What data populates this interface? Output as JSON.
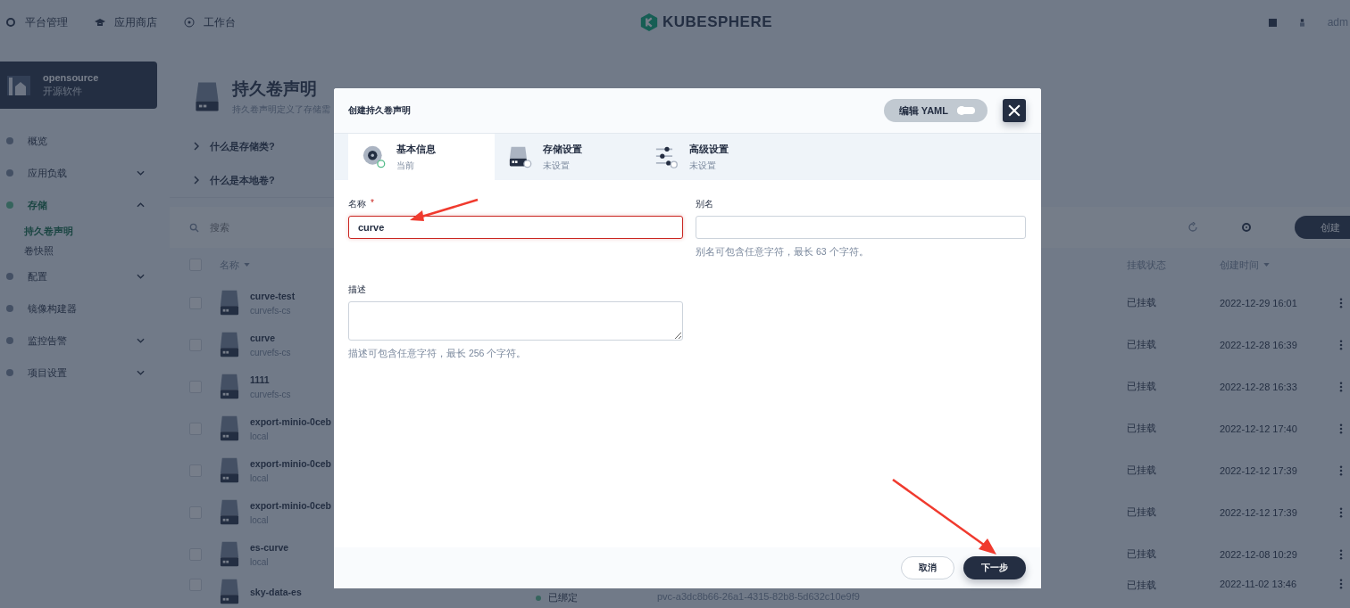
{
  "top_nav": [
    {
      "label": "平台管理",
      "kind": "gear"
    },
    {
      "label": "应用商店",
      "kind": "cap"
    },
    {
      "label": "工作台",
      "kind": "dot"
    }
  ],
  "logo": {
    "text": "KUBESPHERE"
  },
  "user": {
    "name": "adm"
  },
  "workspace": {
    "name": "opensource",
    "description": "开源软件"
  },
  "sidebar": {
    "items": [
      {
        "label": "概览",
        "kind": "link",
        "selected": false
      },
      {
        "label": "应用负载",
        "kind": "group",
        "selected": false,
        "expanded": false
      },
      {
        "label": "存储",
        "kind": "group",
        "selected": true,
        "expanded": true,
        "children": [
          {
            "label": "持久卷声明",
            "selected": true
          },
          {
            "label": "卷快照",
            "selected": false
          }
        ]
      },
      {
        "label": "配置",
        "kind": "group",
        "selected": false,
        "expanded": false
      },
      {
        "label": "镜像构建器",
        "kind": "link",
        "selected": false
      },
      {
        "label": "监控告警",
        "kind": "group",
        "selected": false,
        "expanded": false
      },
      {
        "label": "项目设置",
        "kind": "group",
        "selected": false,
        "expanded": false
      }
    ]
  },
  "page_header": {
    "title": "持久卷声明",
    "description": "持久卷声明定义了存储需"
  },
  "faq": [
    {
      "question": "什么是存储类?",
      "expanded": false
    },
    {
      "question": "什么是本地卷?",
      "expanded": false
    }
  ],
  "toolbar": {
    "search": {
      "placeholder": "搜索"
    },
    "create_button": "创建"
  },
  "table": {
    "all_checked": false,
    "columns": [
      {
        "label": "名称",
        "sortable": true
      },
      {
        "label": "挂载状态",
        "sortable": false
      },
      {
        "label": "创建时间",
        "sortable": true
      }
    ],
    "rows": [
      {
        "name": "curve-test",
        "storage_class": "curvefs-cs",
        "mount": "已挂载",
        "created": "2022-12-29 16:01",
        "checked": false
      },
      {
        "name": "curve",
        "storage_class": "curvefs-cs",
        "mount": "已挂载",
        "created": "2022-12-28 16:39",
        "checked": false
      },
      {
        "name": "1111",
        "storage_class": "curvefs-cs",
        "mount": "已挂载",
        "created": "2022-12-28 16:33",
        "checked": false
      },
      {
        "name": "export-minio-0ceb",
        "storage_class": "local",
        "mount": "已挂载",
        "created": "2022-12-12 17:40",
        "checked": false
      },
      {
        "name": "export-minio-0ceb",
        "storage_class": "local",
        "mount": "已挂载",
        "created": "2022-12-12 17:39",
        "checked": false
      },
      {
        "name": "export-minio-0ceb",
        "storage_class": "local",
        "mount": "已挂载",
        "created": "2022-12-12 17:39",
        "checked": false
      },
      {
        "name": "es-curve",
        "storage_class": "local",
        "mount": "已挂载",
        "created": "2022-12-08 10:29",
        "checked": false
      },
      {
        "name": "sky-data-es",
        "status": "已绑定",
        "volume": "pvc-a3dc8b66-26a1-4315-82b8-5d632c10e9f9",
        "mount": "已挂载",
        "created": "2022-11-02 13:46",
        "checked": false
      }
    ]
  },
  "modal": {
    "title": "创建持久卷声明",
    "yaml_toggle": {
      "label": "编辑 YAML",
      "on": false
    },
    "steps": [
      {
        "title": "基本信息",
        "status": "当前",
        "selected": true,
        "kind": "disk"
      },
      {
        "title": "存储设置",
        "status": "未设置",
        "selected": false,
        "kind": "drive"
      },
      {
        "title": "高级设置",
        "status": "未设置",
        "selected": false,
        "kind": "sliders"
      }
    ],
    "fields": [
      {
        "label": "名称",
        "required_mark": "*",
        "value": "curve",
        "invalid": true,
        "kind": "input"
      },
      {
        "label": "别名",
        "hint": "别名可包含任意字符，最长 63 个字符。",
        "kind": "input"
      },
      {
        "label": "描述",
        "hint": "描述可包含任意字符，最长 256 个字符。",
        "kind": "textarea"
      }
    ],
    "buttons": [
      {
        "label": "取消",
        "kind": "secondary"
      },
      {
        "label": "下一步",
        "kind": "primary"
      }
    ]
  }
}
